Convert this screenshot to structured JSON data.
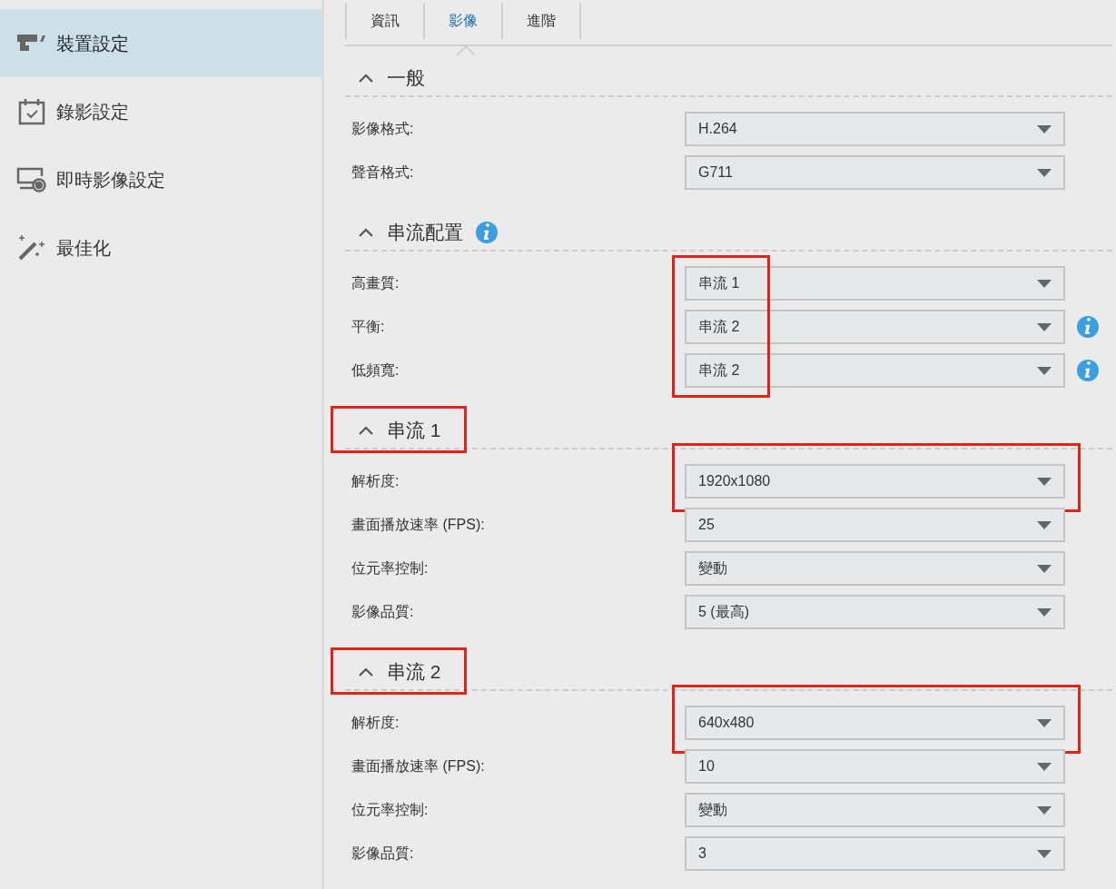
{
  "sidebar": {
    "items": [
      {
        "label": "裝置設定",
        "selected": true
      },
      {
        "label": "錄影設定",
        "selected": false
      },
      {
        "label": "即時影像設定",
        "selected": false
      },
      {
        "label": "最佳化",
        "selected": false
      }
    ]
  },
  "tabs": [
    {
      "label": "資訊",
      "selected": false
    },
    {
      "label": "影像",
      "selected": true
    },
    {
      "label": "進階",
      "selected": false
    }
  ],
  "sections": [
    {
      "title": "一般",
      "expanded": true,
      "info": false,
      "annotated": false,
      "values_annotated": false,
      "fields": [
        {
          "label": "影像格式:",
          "value": "H.264",
          "info": false,
          "annotated": false
        },
        {
          "label": "聲音格式:",
          "value": "G711",
          "info": false,
          "annotated": false
        }
      ]
    },
    {
      "title": "串流配置",
      "expanded": true,
      "info": true,
      "annotated": false,
      "values_annotated": true,
      "fields": [
        {
          "label": "高畫質:",
          "value": "串流 1",
          "info": false,
          "annotated": false
        },
        {
          "label": "平衡:",
          "value": "串流 2",
          "info": true,
          "annotated": false
        },
        {
          "label": "低頻寬:",
          "value": "串流 2",
          "info": true,
          "annotated": false
        }
      ]
    },
    {
      "title": "串流 1",
      "expanded": true,
      "info": false,
      "annotated": true,
      "values_annotated": false,
      "fields": [
        {
          "label": "解析度:",
          "value": "1920x1080",
          "info": false,
          "annotated": true
        },
        {
          "label": "畫面播放速率 (FPS):",
          "value": "25",
          "info": false,
          "annotated": false
        },
        {
          "label": "位元率控制:",
          "value": "變動",
          "info": false,
          "annotated": false
        },
        {
          "label": "影像品質:",
          "value": "5 (最高)",
          "info": false,
          "annotated": false
        }
      ]
    },
    {
      "title": "串流 2",
      "expanded": true,
      "info": false,
      "annotated": true,
      "values_annotated": false,
      "fields": [
        {
          "label": "解析度:",
          "value": "640x480",
          "info": false,
          "annotated": true
        },
        {
          "label": "畫面播放速率 (FPS):",
          "value": "10",
          "info": false,
          "annotated": false
        },
        {
          "label": "位元率控制:",
          "value": "變動",
          "info": false,
          "annotated": false
        },
        {
          "label": "影像品質:",
          "value": "3",
          "info": false,
          "annotated": false
        }
      ]
    }
  ]
}
